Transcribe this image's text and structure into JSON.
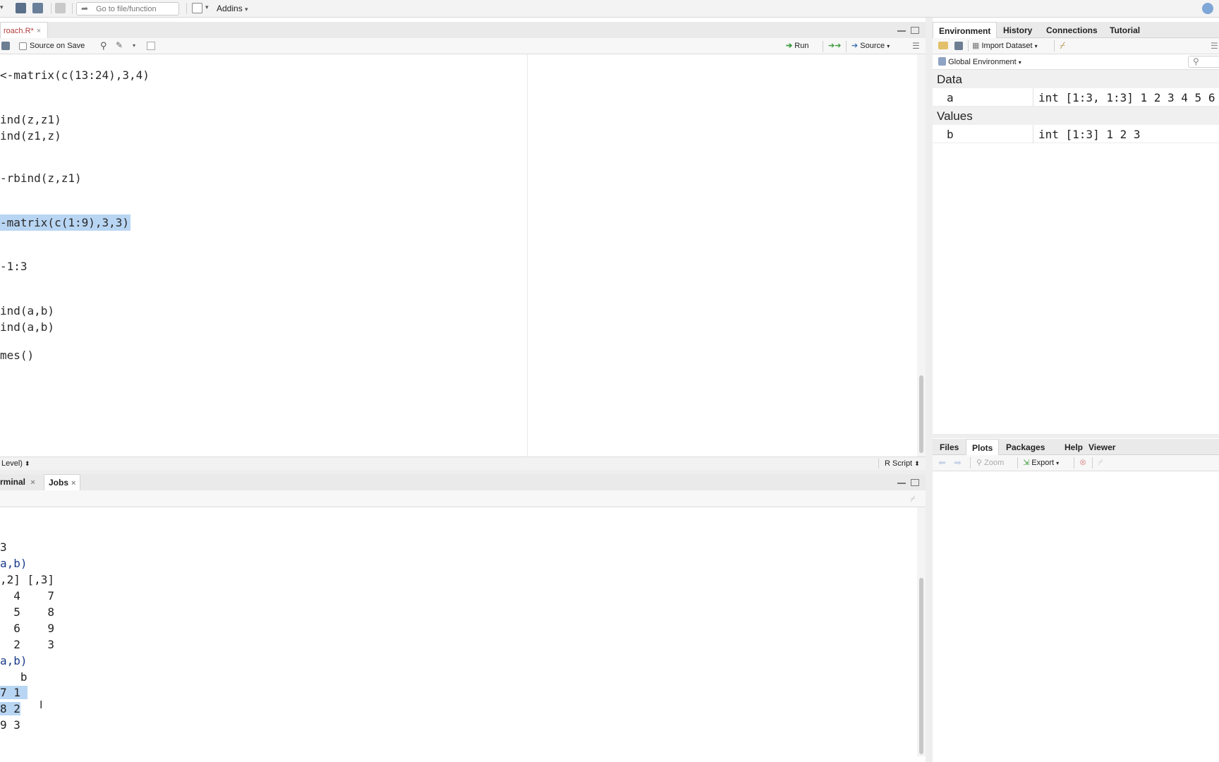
{
  "toolbar": {
    "goto_placeholder": "Go to file/function",
    "addins_label": "Addins"
  },
  "editor": {
    "tab_label": "roach.R*",
    "source_on_save": "Source on Save",
    "run_label": "Run",
    "source_label": "Source",
    "lines": [
      {
        "text": "<-matrix(c(13:24),3,4)",
        "selected": false
      },
      {
        "text": "ind(z,z1)",
        "selected": false
      },
      {
        "text": "ind(z1,z)",
        "selected": false
      },
      {
        "text": "-rbind(z,z1)",
        "selected": false
      },
      {
        "text": "-matrix(c(1:9),3,3)",
        "selected": true
      },
      {
        "text": "-1:3",
        "selected": false
      },
      {
        "text": "ind(a,b)",
        "selected": false
      },
      {
        "text": "ind(a,b)",
        "selected": false
      },
      {
        "text": "mes()",
        "selected": false
      }
    ],
    "status_left": "Level)",
    "status_right": "R Script"
  },
  "console": {
    "tabs": [
      "rminal",
      "Jobs"
    ],
    "lines": [
      {
        "text": "3",
        "cmd": false,
        "sel": ""
      },
      {
        "text": "a,b)",
        "cmd": true,
        "sel": ""
      },
      {
        "text": ",2] [,3]",
        "cmd": false,
        "sel": ""
      },
      {
        "text": "  4    7",
        "cmd": false,
        "sel": ""
      },
      {
        "text": "  5    8",
        "cmd": false,
        "sel": ""
      },
      {
        "text": "  6    9",
        "cmd": false,
        "sel": ""
      },
      {
        "text": "  2    3",
        "cmd": false,
        "sel": ""
      },
      {
        "text": "a,b)",
        "cmd": true,
        "sel": ""
      },
      {
        "text": "   b",
        "cmd": false,
        "sel": ""
      },
      {
        "text": "7 1",
        "cmd": false,
        "sel": "full"
      },
      {
        "text": "8 2",
        "cmd": false,
        "sel": "full"
      },
      {
        "text": "9 3",
        "cmd": false,
        "sel": ""
      }
    ]
  },
  "env_pane": {
    "tabs": [
      "Environment",
      "History",
      "Connections",
      "Tutorial"
    ],
    "active_tab": "Environment",
    "import_label": "Import Dataset",
    "scope_label": "Global Environment",
    "sections": [
      {
        "title": "Data",
        "rows": [
          {
            "name": "a",
            "value": "int [1:3, 1:3] 1 2 3 4 5 6"
          }
        ]
      },
      {
        "title": "Values",
        "rows": [
          {
            "name": "b",
            "value": "int [1:3] 1 2 3"
          }
        ]
      }
    ]
  },
  "files_pane": {
    "tabs": [
      "Files",
      "Plots",
      "Packages",
      "Help",
      "Viewer"
    ],
    "active_tab": "Plots",
    "zoom_label": "Zoom",
    "export_label": "Export"
  },
  "colors": {
    "selection": "#b8d5f3",
    "accent_green": "#3a9a3a"
  }
}
